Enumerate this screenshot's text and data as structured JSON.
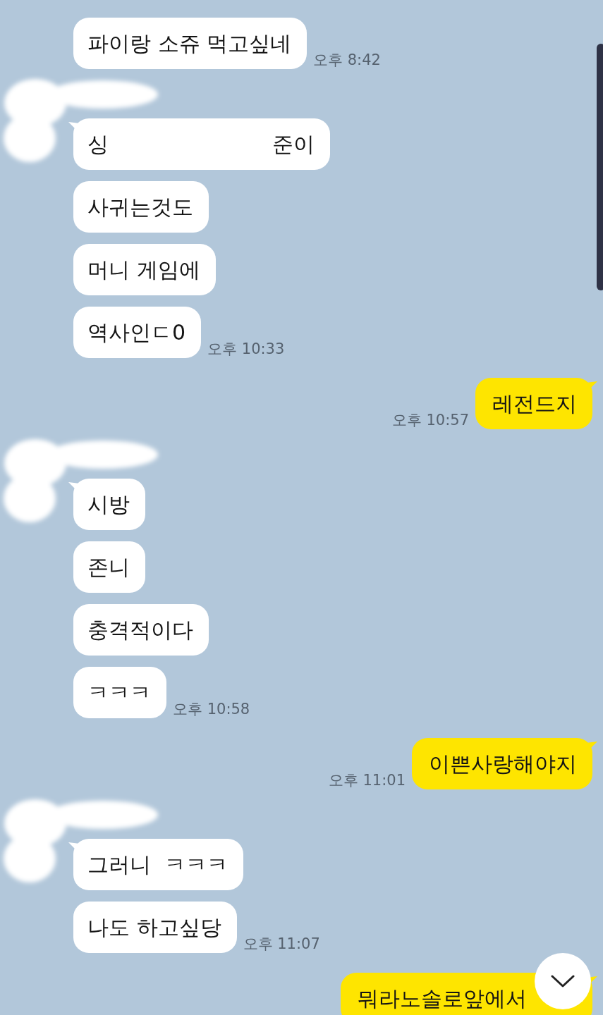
{
  "chat": {
    "groups": [
      {
        "kind": "received",
        "sender_redacted": false,
        "messages": [
          {
            "kind": "text",
            "text": "파이랑 소쥬 먹고싶네",
            "tail": false,
            "time": "오후 8:42"
          }
        ]
      },
      {
        "kind": "received",
        "sender_redacted": true,
        "messages": [
          {
            "kind": "redacted",
            "parts": [
              "싱",
              "준이"
            ],
            "tail": true
          },
          {
            "kind": "text",
            "text": "사귀는것도",
            "tail": false
          },
          {
            "kind": "text",
            "text": "머니 게임에",
            "tail": false
          },
          {
            "kind": "text",
            "text": "역사인ㄷ0",
            "tail": false,
            "time": "오후 10:33"
          }
        ]
      },
      {
        "kind": "sent",
        "sender_redacted": false,
        "messages": [
          {
            "kind": "text",
            "text": "레전드지",
            "tail": true,
            "time": "오후 10:57"
          }
        ]
      },
      {
        "kind": "received",
        "sender_redacted": true,
        "messages": [
          {
            "kind": "text",
            "text": "시방",
            "tail": true
          },
          {
            "kind": "text",
            "text": "존니",
            "tail": false
          },
          {
            "kind": "text",
            "text": "충격적이다",
            "tail": false
          },
          {
            "kind": "text",
            "text": "ㅋㅋㅋ",
            "tail": false,
            "time": "오후 10:58"
          }
        ]
      },
      {
        "kind": "sent",
        "sender_redacted": false,
        "messages": [
          {
            "kind": "text",
            "text": "이쁜사랑해야지",
            "tail": true,
            "time": "오후 11:01"
          }
        ]
      },
      {
        "kind": "received",
        "sender_redacted": true,
        "messages": [
          {
            "kind": "text",
            "text": "그러니  ㅋㅋㅋ",
            "tail": true
          },
          {
            "kind": "text",
            "text": "나도 하고싶당",
            "tail": false,
            "time": "오후 11:07"
          }
        ]
      },
      {
        "kind": "sent",
        "sender_redacted": false,
        "messages": [
          {
            "kind": "text",
            "text": "뭐라노솔로앞에서",
            "tail": true
          }
        ]
      }
    ]
  }
}
